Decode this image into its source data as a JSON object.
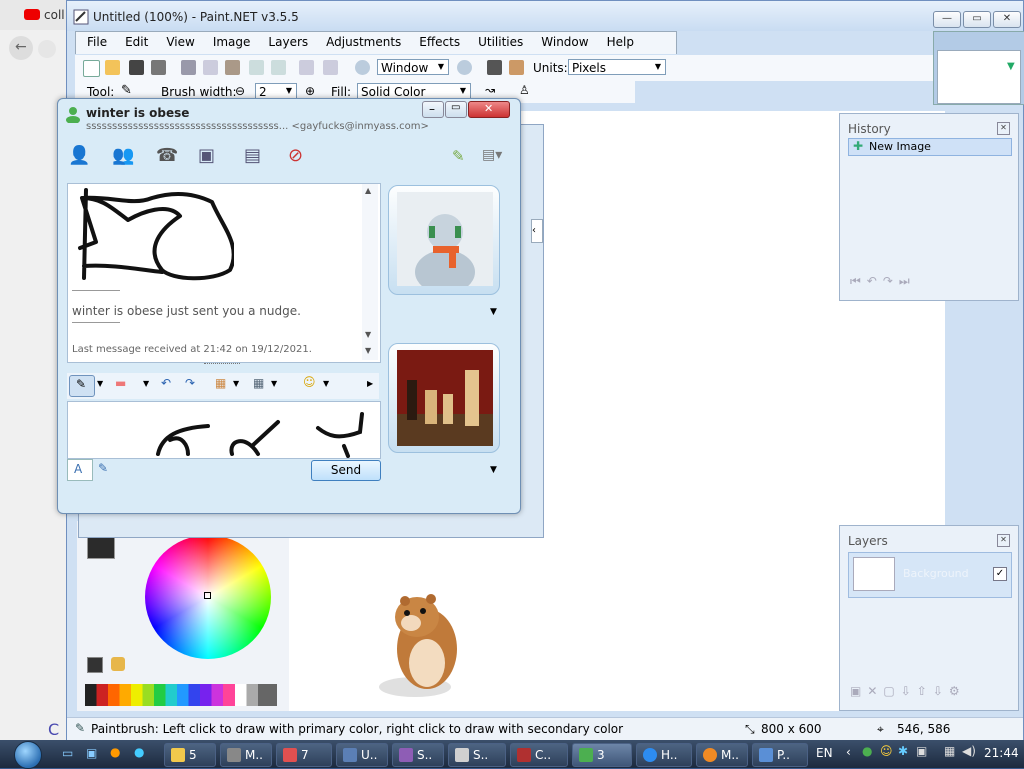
{
  "browser": {
    "tab_label": "coll"
  },
  "paintnet": {
    "title": "Untitled (100%) - Paint.NET v3.5.5",
    "menu": [
      "File",
      "Edit",
      "View",
      "Image",
      "Layers",
      "Adjustments",
      "Effects",
      "Utilities",
      "Window",
      "Help"
    ],
    "zoom_value": "Window",
    "units_label": "Units:",
    "units_value": "Pixels",
    "tool_label": "Tool:",
    "brush_width_label": "Brush width:",
    "brush_width_value": "2",
    "fill_label": "Fill:",
    "fill_value": "Solid Color",
    "history": {
      "title": "History",
      "items": [
        "New Image"
      ]
    },
    "layers": {
      "title": "Layers",
      "items": [
        {
          "name": "Background",
          "visible": true
        }
      ]
    },
    "status": {
      "hint": "Paintbrush: Left click to draw with primary color, right click to draw with secondary color",
      "image_size": "800 x 600",
      "cursor_position": "546, 586"
    }
  },
  "messenger": {
    "contact_name": "winter is obese",
    "contact_status": "sssssssssssssssssssssssssssssssssssss... <gayfucks@inmyass.com>",
    "nudge_message": "winter is obese just sent you a nudge.",
    "last_message": "Last message received at 21:42 on 19/12/2021.",
    "send_label": "Send"
  },
  "taskbar": {
    "buttons": [
      {
        "label": "5",
        "color": "#f2c94c"
      },
      {
        "label": "M..",
        "color": "#888888"
      },
      {
        "label": "7",
        "color": "#e15050"
      },
      {
        "label": "U..",
        "color": "#5b7fb5"
      },
      {
        "label": "S..",
        "color": "#8e5db5"
      },
      {
        "label": "S..",
        "color": "#d0d0d0"
      },
      {
        "label": "C..",
        "color": "#b03030"
      },
      {
        "label": "3",
        "color": "#4caf50"
      },
      {
        "label": "H..",
        "color": "#2d8cf0"
      },
      {
        "label": "M..",
        "color": "#f08a24"
      },
      {
        "label": "P..",
        "color": "#5a8fd6"
      }
    ],
    "language": "EN",
    "clock": "21:44"
  }
}
